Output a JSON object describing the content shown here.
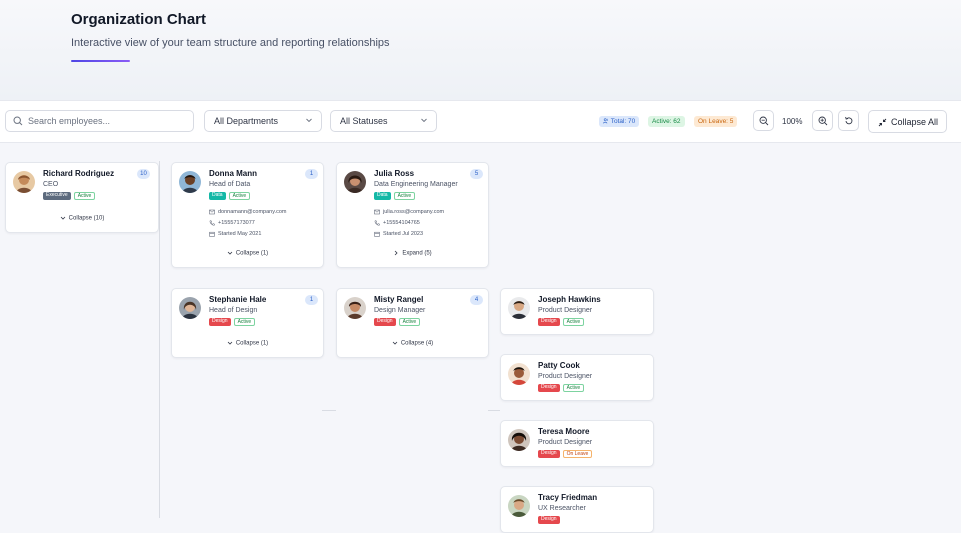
{
  "header": {
    "title": "Organization Chart",
    "subtitle": "Interactive view of your team structure and reporting relationships"
  },
  "toolbar": {
    "search_placeholder": "Search employees...",
    "department_filter": "All Departments",
    "status_filter": "All Statuses",
    "stat_total": "Total: 70",
    "stat_active": "Active: 62",
    "stat_leave": "On Leave: 5",
    "zoom_level": "100%",
    "collapse_all_label": "Collapse All"
  },
  "colors": {
    "accent": "#4f46e5",
    "design": "#e5484d",
    "data": "#14b8a6",
    "executive": "#5d6b7e"
  },
  "cards": {
    "richard": {
      "name": "Richard Rodriguez",
      "role": "CEO",
      "dept": "Executive",
      "status": "Active",
      "count": "10",
      "toggle": "Collapse (10)"
    },
    "donna": {
      "name": "Donna Mann",
      "role": "Head of Data",
      "dept": "Data",
      "status": "Active",
      "count": "1",
      "email": "donnamann@company.com",
      "phone": "+15557173077",
      "started": "Started May 2021",
      "toggle": "Collapse (1)"
    },
    "julia": {
      "name": "Julia Ross",
      "role": "Data Engineering Manager",
      "dept": "Data",
      "status": "Active",
      "count": "5",
      "email": "julia.ross@company.com",
      "phone": "+15554104765",
      "started": "Started Jul 2023",
      "toggle": "Expand (5)"
    },
    "stephanie": {
      "name": "Stephanie Hale",
      "role": "Head of Design",
      "dept": "Design",
      "status": "Active",
      "count": "1",
      "toggle": "Collapse (1)"
    },
    "misty": {
      "name": "Misty Rangel",
      "role": "Design Manager",
      "dept": "Design",
      "status": "Active",
      "count": "4",
      "toggle": "Collapse (4)"
    },
    "joseph": {
      "name": "Joseph Hawkins",
      "role": "Product Designer",
      "dept": "Design",
      "status": "Active"
    },
    "patty": {
      "name": "Patty Cook",
      "role": "Product Designer",
      "dept": "Design",
      "status": "Active"
    },
    "teresa": {
      "name": "Teresa Moore",
      "role": "Product Designer",
      "dept": "Design",
      "status": "On Leave"
    },
    "tracy": {
      "name": "Tracy Friedman",
      "role": "UX Researcher",
      "dept": "Design",
      "status": ""
    }
  }
}
